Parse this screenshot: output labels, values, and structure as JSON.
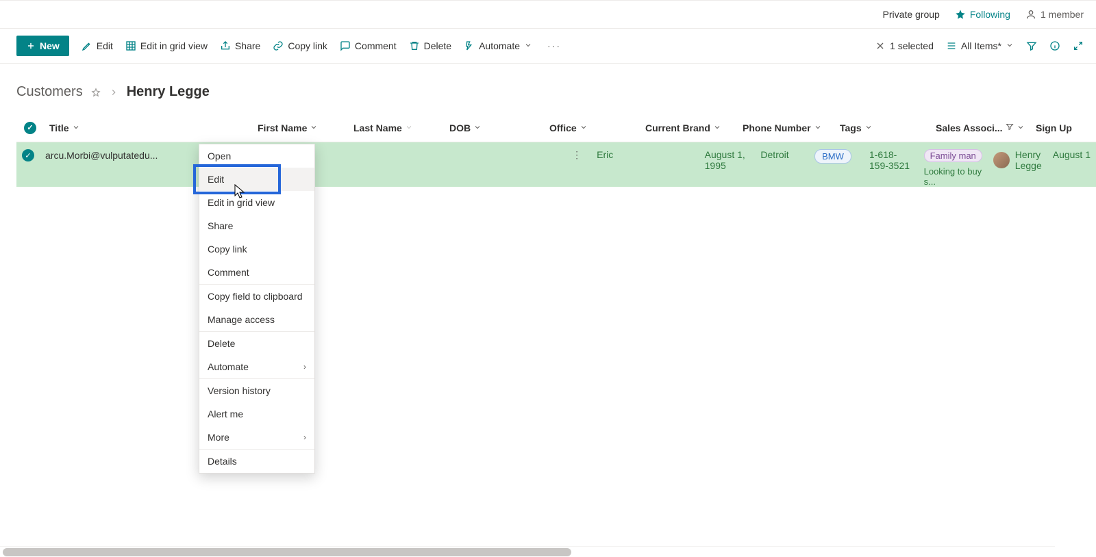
{
  "groupbar": {
    "privacy": "Private group",
    "following": "Following",
    "members": "1 member"
  },
  "commands": {
    "new": "New",
    "edit": "Edit",
    "edit_grid": "Edit in grid view",
    "share": "Share",
    "copylink": "Copy link",
    "comment": "Comment",
    "delete": "Delete",
    "automate": "Automate"
  },
  "right_commands": {
    "selected": "1 selected",
    "view": "All Items*"
  },
  "breadcrumb": {
    "root": "Customers",
    "current": "Henry Legge"
  },
  "columns": {
    "title": "Title",
    "first_name": "First Name",
    "last_name": "Last Name",
    "dob": "DOB",
    "office": "Office",
    "brand": "Current Brand",
    "phone": "Phone Number",
    "tags": "Tags",
    "associate": "Sales Associ...",
    "signup": "Sign Up"
  },
  "row": {
    "title": "arcu.Morbi@vulputatedu...",
    "first_name": "Eric",
    "last_name": "",
    "dob": "August 1, 1995",
    "office": "Detroit",
    "brand": "BMW",
    "phone": "1-618-159-3521",
    "tag1": "Family man",
    "tag2": "Looking to buy s...",
    "associate": "Henry Legge",
    "signup": "August 1"
  },
  "context_menu": {
    "items": [
      "Open",
      "Edit",
      "Edit in grid view",
      "Share",
      "Copy link",
      "Comment",
      "Copy field to clipboard",
      "Manage access",
      "Delete",
      "Automate",
      "Version history",
      "Alert me",
      "More",
      "Details"
    ]
  }
}
